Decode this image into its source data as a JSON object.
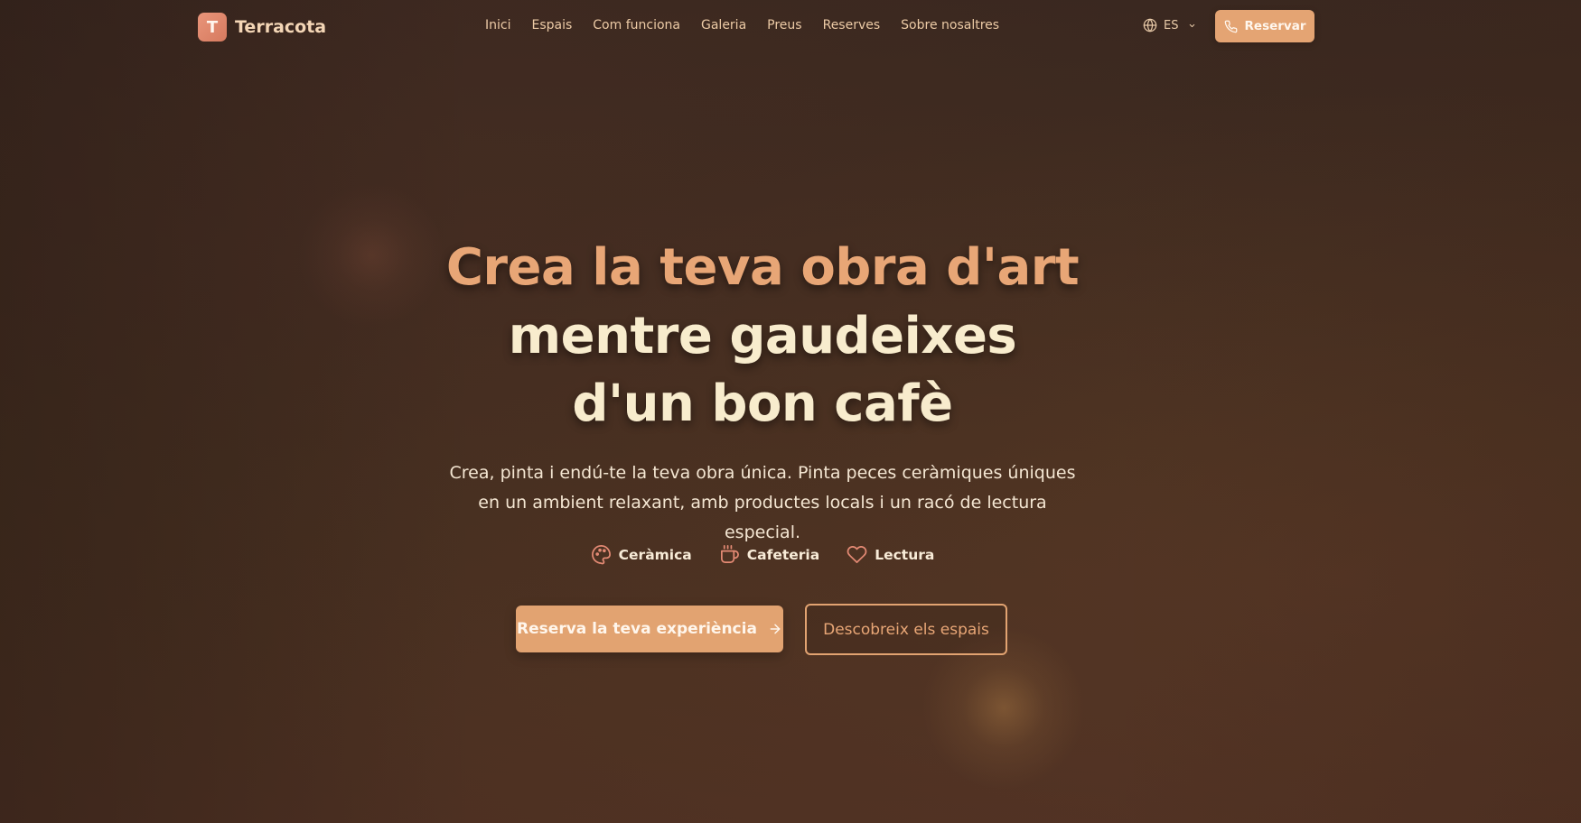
{
  "brand": {
    "logo_letter": "T",
    "name": "Terracota"
  },
  "nav": {
    "items": [
      {
        "label": "Inici"
      },
      {
        "label": "Espais"
      },
      {
        "label": "Com funciona"
      },
      {
        "label": "Galeria"
      },
      {
        "label": "Preus"
      },
      {
        "label": "Reserves"
      },
      {
        "label": "Sobre nosaltres"
      }
    ]
  },
  "language": {
    "icon": "globe-icon",
    "selected": "ES"
  },
  "header_cta": {
    "icon": "phone-icon",
    "label": "Reservar"
  },
  "hero": {
    "title_line1": "Crea la teva obra d'art",
    "title_line2": "mentre gaudeixes",
    "title_line3": "d'un bon cafè",
    "subtitle": "Crea, pinta i endú-te la teva obra única. Pinta peces ceràmiques úniques en un ambient relaxant, amb productes locals i un racó de lectura especial.",
    "features": [
      {
        "icon": "palette-icon",
        "label": "Ceràmica"
      },
      {
        "icon": "coffee-cup-icon",
        "label": "Cafeteria"
      },
      {
        "icon": "heart-icon",
        "label": "Lectura"
      }
    ],
    "primary_cta": "Reserva la teva experiència",
    "secondary_cta": "Descobreix els espais"
  },
  "colors": {
    "accent": "#e2a371",
    "title_accent": "#e8a676",
    "title_light": "#f8eccd",
    "background": "#3f2a21",
    "logo": "#e08a6e"
  }
}
